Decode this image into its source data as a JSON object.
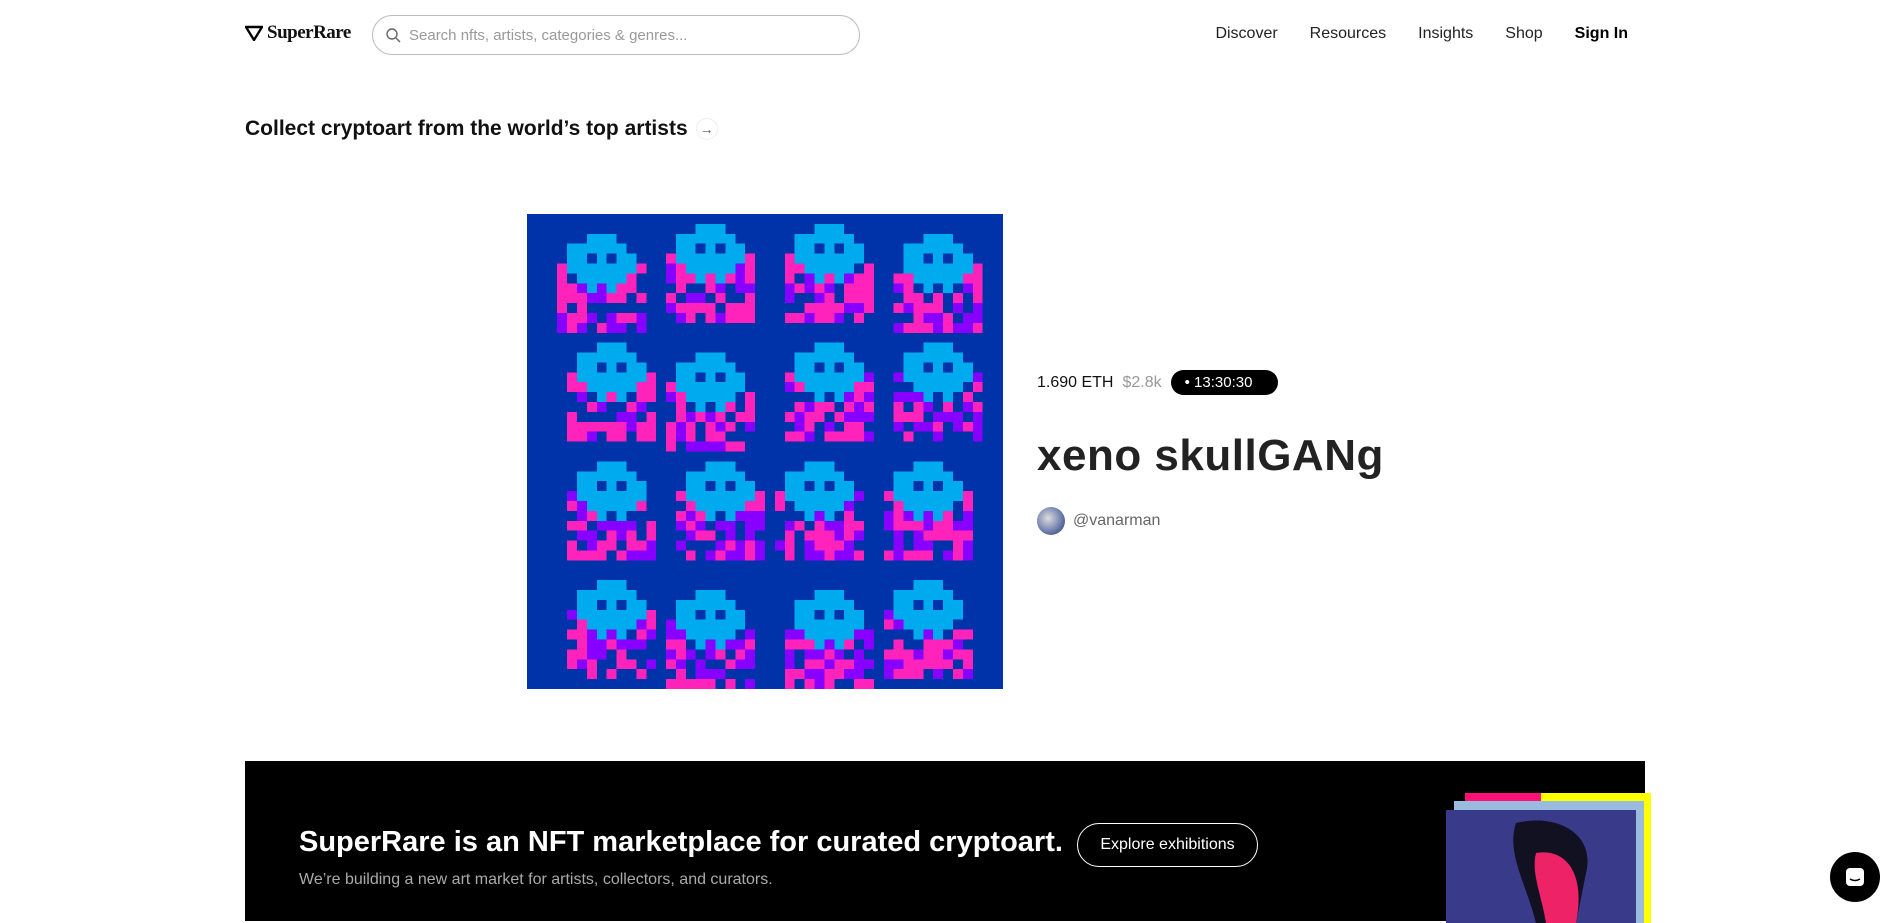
{
  "header": {
    "logo": "SuperRare",
    "search_placeholder": "Search nfts, artists, categories & genres...",
    "nav": [
      "Discover",
      "Resources",
      "Insights",
      "Shop"
    ],
    "sign_in": "Sign In"
  },
  "section": {
    "heading": "Collect cryptoart from the world’s top artists"
  },
  "featured": {
    "price_eth": "1.690 ETH",
    "price_usd": "$2.8k",
    "timer": "13:30:30",
    "title": "xeno skullGANg",
    "artist": "@vanarman",
    "colors": {
      "background": "#0033aa",
      "skull": "#00aaee",
      "pink": "#ff22bb",
      "purple": "#8800ff"
    }
  },
  "banner": {
    "title": "SuperRare is an NFT marketplace for curated cryptoart.",
    "subtitle": "We’re building a new art market for artists, collectors, and curators.",
    "button": "Explore exhibitions"
  },
  "icons": {
    "logo": "diamond-icon",
    "search": "search-icon",
    "arrow": "arrow-right-icon",
    "chat": "chat-icon"
  }
}
